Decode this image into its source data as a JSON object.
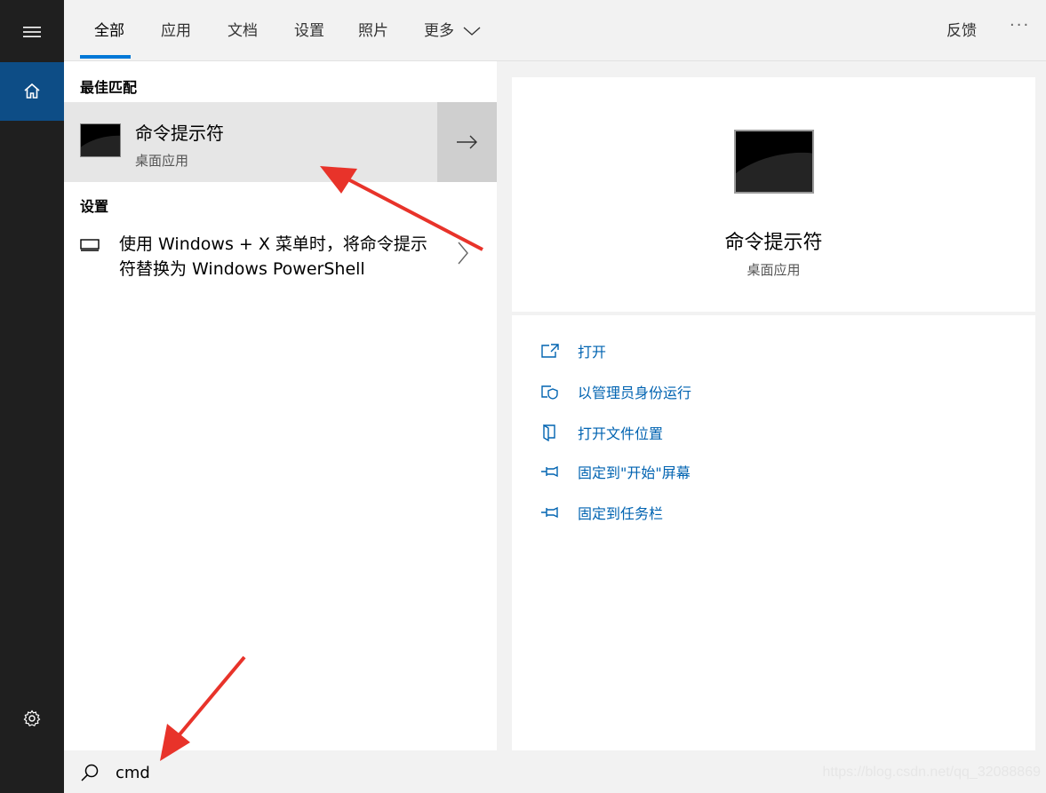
{
  "colors": {
    "accent": "#0078d7",
    "rail": "#1f1f1f",
    "home_active": "#0d4d86",
    "link": "#0063b1",
    "annotation": "#e8332a"
  },
  "rail": {
    "menu_icon": "hamburger-icon",
    "home_icon": "home-icon",
    "settings_icon": "gear-icon"
  },
  "tabs": [
    {
      "label": "全部",
      "active": true
    },
    {
      "label": "应用",
      "active": false
    },
    {
      "label": "文档",
      "active": false
    },
    {
      "label": "设置",
      "active": false
    },
    {
      "label": "照片",
      "active": false
    },
    {
      "label": "更多",
      "active": false
    }
  ],
  "header": {
    "feedback": "反馈",
    "more_options": "···"
  },
  "results": {
    "best_match_title": "最佳匹配",
    "best_match": {
      "name": "命令提示符",
      "type": "桌面应用"
    },
    "settings_title": "设置",
    "settings_item": {
      "text": "使用 Windows + X 菜单时，将命令提示符替换为 Windows PowerShell"
    }
  },
  "detail": {
    "name": "命令提示符",
    "type": "桌面应用",
    "actions": [
      {
        "label": "打开",
        "icon": "open-icon"
      },
      {
        "label": "以管理员身份运行",
        "icon": "shield-admin-icon"
      },
      {
        "label": "打开文件位置",
        "icon": "file-location-icon"
      },
      {
        "label": "固定到\"开始\"屏幕",
        "icon": "pin-icon"
      },
      {
        "label": "固定到任务栏",
        "icon": "pin-icon"
      }
    ]
  },
  "search": {
    "value": "cmd"
  },
  "watermark": "https://blog.csdn.net/qq_32088869"
}
